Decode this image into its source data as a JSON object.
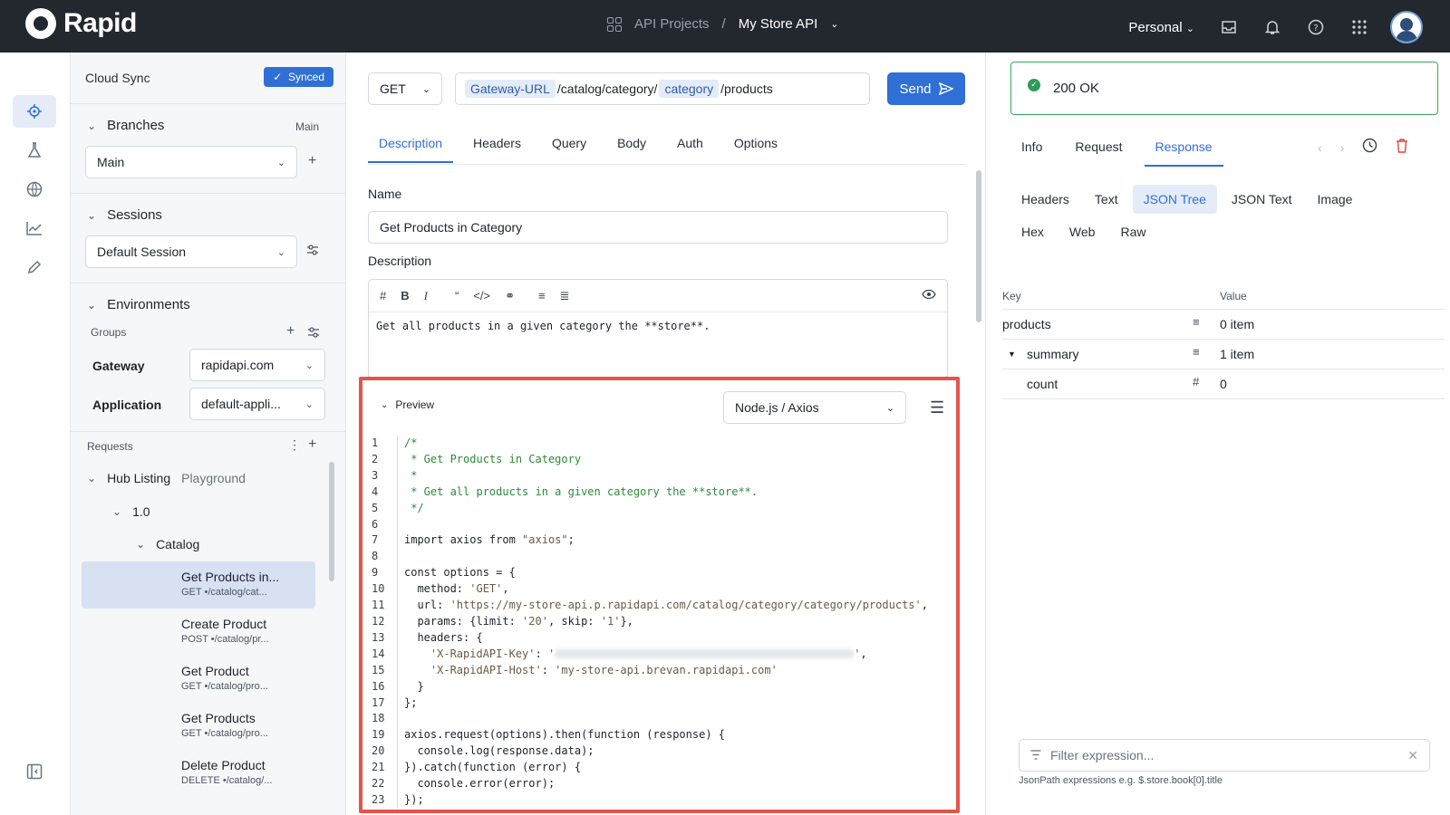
{
  "app": {
    "logo_text": "Rapid"
  },
  "header": {
    "projects_label": "API Projects",
    "separator": "/",
    "api_name": "My Store API",
    "workspace": "Personal"
  },
  "sidebar": {
    "cloud_sync": "Cloud Sync",
    "synced_label": "Synced",
    "branches": {
      "title": "Branches",
      "current": "Main",
      "selected": "Main"
    },
    "sessions": {
      "title": "Sessions",
      "selected": "Default Session"
    },
    "environments": {
      "title": "Environments",
      "groups_label": "Groups",
      "rows": [
        {
          "label": "Gateway",
          "value": "rapidapi.com"
        },
        {
          "label": "Application",
          "value": "default-appli..."
        }
      ]
    },
    "requests": {
      "title": "Requests",
      "tree": {
        "listing": "Hub Listing",
        "listing_sub": "Playground",
        "version": "1.0",
        "folder": "Catalog"
      },
      "items": [
        {
          "name": "Get Products in...",
          "path": "GET •/catalog/cat..."
        },
        {
          "name": "Create Product",
          "path": "POST •/catalog/pr..."
        },
        {
          "name": "Get Product",
          "path": "GET •/catalog/pro..."
        },
        {
          "name": "Get Products",
          "path": "GET •/catalog/pro..."
        },
        {
          "name": "Delete Product",
          "path": "DELETE •/catalog/..."
        }
      ]
    }
  },
  "request": {
    "method": "GET",
    "url": {
      "chip1": "Gateway-URL",
      "seg1": "/catalog/category/",
      "chip2": "category",
      "seg2": "/products"
    },
    "send_label": "Send",
    "tabs": [
      "Description",
      "Headers",
      "Query",
      "Body",
      "Auth",
      "Options"
    ],
    "name_label": "Name",
    "name_value": "Get Products in Category",
    "description_label": "Description",
    "description_text": "Get all products in a given category the **store**."
  },
  "preview": {
    "title": "Preview",
    "language": "Node.js / Axios",
    "lines": [
      {
        "n": "1",
        "parts": [
          {
            "c": "cm",
            "t": "/*"
          }
        ]
      },
      {
        "n": "2",
        "parts": [
          {
            "c": "cm",
            "t": " * Get Products in Category"
          }
        ]
      },
      {
        "n": "3",
        "parts": [
          {
            "c": "cm",
            "t": " *"
          }
        ]
      },
      {
        "n": "4",
        "parts": [
          {
            "c": "cm",
            "t": " * Get all products in a given category the **store**."
          }
        ]
      },
      {
        "n": "5",
        "parts": [
          {
            "c": "cm",
            "t": " */"
          }
        ]
      },
      {
        "n": "6",
        "parts": []
      },
      {
        "n": "7",
        "parts": [
          {
            "c": "ct",
            "t": "import axios from "
          },
          {
            "c": "st",
            "t": "\"axios\""
          },
          {
            "c": "ct",
            "t": ";"
          }
        ]
      },
      {
        "n": "8",
        "parts": []
      },
      {
        "n": "9",
        "parts": [
          {
            "c": "ct",
            "t": "const options = {"
          }
        ]
      },
      {
        "n": "10",
        "parts": [
          {
            "c": "ct",
            "t": "  method: "
          },
          {
            "c": "st",
            "t": "'GET'"
          },
          {
            "c": "ct",
            "t": ","
          }
        ]
      },
      {
        "n": "11",
        "parts": [
          {
            "c": "ct",
            "t": "  url: "
          },
          {
            "c": "st",
            "t": "'https://my-store-api.p.rapidapi.com/catalog/category/category/products'"
          },
          {
            "c": "ct",
            "t": ","
          }
        ]
      },
      {
        "n": "12",
        "parts": [
          {
            "c": "ct",
            "t": "  params: {limit: "
          },
          {
            "c": "st",
            "t": "'20'"
          },
          {
            "c": "ct",
            "t": ", skip: "
          },
          {
            "c": "st",
            "t": "'1'"
          },
          {
            "c": "ct",
            "t": "},"
          }
        ]
      },
      {
        "n": "13",
        "parts": [
          {
            "c": "ct",
            "t": "  headers: {"
          }
        ]
      },
      {
        "n": "14",
        "parts": [
          {
            "c": "st",
            "t": "    'X-RapidAPI-Key'"
          },
          {
            "c": "ct",
            "t": ": "
          },
          {
            "c": "st",
            "t": "'"
          },
          {
            "c": "blur",
            "t": ""
          },
          {
            "c": "st",
            "t": "'"
          },
          {
            "c": "ct",
            "t": ","
          }
        ]
      },
      {
        "n": "15",
        "parts": [
          {
            "c": "st",
            "t": "    'X-RapidAPI-Host'"
          },
          {
            "c": "ct",
            "t": ": "
          },
          {
            "c": "st",
            "t": "'my-store-api.brevan.rapidapi.com'"
          }
        ]
      },
      {
        "n": "16",
        "parts": [
          {
            "c": "ct",
            "t": "  }"
          }
        ]
      },
      {
        "n": "17",
        "parts": [
          {
            "c": "ct",
            "t": "};"
          }
        ]
      },
      {
        "n": "18",
        "parts": []
      },
      {
        "n": "19",
        "parts": [
          {
            "c": "ct",
            "t": "axios.request(options).then(function (response) {"
          }
        ]
      },
      {
        "n": "20",
        "parts": [
          {
            "c": "ct",
            "t": "  console.log(response.data);"
          }
        ]
      },
      {
        "n": "21",
        "parts": [
          {
            "c": "ct",
            "t": "}).catch(function (error) {"
          }
        ]
      },
      {
        "n": "22",
        "parts": [
          {
            "c": "ct",
            "t": "  console.error(error);"
          }
        ]
      },
      {
        "n": "23",
        "parts": [
          {
            "c": "ct",
            "t": "});"
          }
        ]
      }
    ]
  },
  "response": {
    "status": "200 OK",
    "status_color": "#2f9a5a",
    "tabs": [
      "Info",
      "Request",
      "Response"
    ],
    "views": [
      "Headers",
      "Text",
      "JSON Tree",
      "JSON Text",
      "Image",
      "Hex",
      "Web",
      "Raw"
    ],
    "active_view": "JSON Tree",
    "columns": {
      "key": "Key",
      "value": "Value"
    },
    "rows": [
      {
        "key": "products",
        "type_icon": "list-icon",
        "type": "≡",
        "value": "0 item"
      },
      {
        "key": "summary",
        "type_icon": "list-icon",
        "type": "≡",
        "value": "1 item"
      },
      {
        "key": "count",
        "type_icon": "number-icon",
        "type": "#",
        "value": "0"
      }
    ],
    "filter_placeholder": "Filter expression...",
    "filter_hint": "JsonPath expressions e.g. $.store.book[0].title"
  },
  "colors": {
    "accent": "#2f6fd6",
    "header_bg": "#23282f",
    "highlight_border": "#e5544b"
  }
}
